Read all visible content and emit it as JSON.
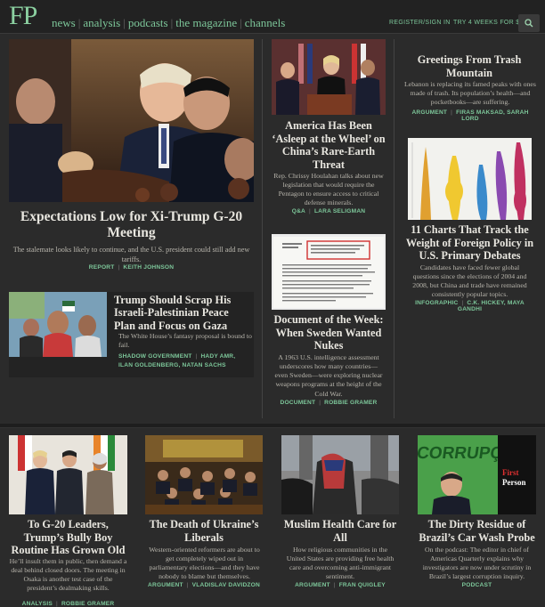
{
  "nav": {
    "logo": "FP",
    "links": [
      "news",
      "analysis",
      "podcasts",
      "the magazine",
      "channels"
    ],
    "register": "REGISTER/SIGN IN",
    "trial": "TRY 4 WEEKS FOR $1"
  },
  "main": {
    "title": "Expectations Low for Xi-Trump G-20 Meeting",
    "dek": "The stalemate looks likely to continue, and the U.S. president could still add new tariffs.",
    "type": "REPORT",
    "author": "KEITH JOHNSON"
  },
  "gaza": {
    "title": "Trump Should Scrap His Israeli-Palestinian Peace Plan and Focus on Gaza",
    "dek": "The White House’s fantasy proposal is bound to fail.",
    "type": "SHADOW GOVERNMENT",
    "author": "HADY AMR, ILAN GOLDENBERG, NATAN SACHS"
  },
  "rare": {
    "title": "America Has Been ‘Asleep at the Wheel’ on China’s Rare-Earth Threat",
    "dek": "Rep. Chrissy Houlahan talks about new legislation that would require the Pentagon to ensure access to critical defense minerals.",
    "type": "Q&A",
    "author": "LARA SELIGMAN"
  },
  "sweden": {
    "title": "Document of the Week: When Sweden Wanted Nukes",
    "dek": "A 1963 U.S. intelligence assessment underscores how many countries—even Sweden—were exploring nuclear weapons programs at the height of the Cold War.",
    "type": "DOCUMENT",
    "author": "ROBBIE GRAMER"
  },
  "trash": {
    "title": "Greetings From Trash Mountain",
    "dek": "Lebanon is replacing its famed peaks with ones made of trash. Its population’s health—and pocketbooks—are suffering.",
    "type": "ARGUMENT",
    "author": "FIRAS MAKSAD, SARAH LORD"
  },
  "charts": {
    "title": "11 Charts That Track the Weight of Foreign Policy in U.S. Primary Debates",
    "dek": "Candidates have faced fewer global questions since the elections of 2004 and 2008, but China and trade have remained consistently popular topics.",
    "type": "INFOGRAPHIC",
    "author": "C.K. HICKEY, MAYA GANDHI"
  },
  "bottom": [
    {
      "title": "To G-20 Leaders, Trump’s Bully Boy Routine Has Grown Old",
      "dek": "He’ll insult them in public, then demand a deal behind closed doors. The meeting in Osaka is another test case of the president’s dealmaking skills.",
      "type": "ANALYSIS",
      "author": "ROBBIE GRAMER"
    },
    {
      "title": "The Death of Ukraine’s Liberals",
      "dek": "Western-oriented reformers are about to get completely wiped out in parliamentary elections—and they have nobody to blame but themselves.",
      "type": "ARGUMENT",
      "author": "VLADISLAV DAVIDZON"
    },
    {
      "title": "Muslim Health Care for All",
      "dek": "How religious communities in the United States are providing free health care and overcoming anti-immigrant sentiment.",
      "type": "ARGUMENT",
      "author": "FRAN QUIGLEY"
    },
    {
      "title": "The Dirty Residue of Brazil’s Car Wash Probe",
      "dek": "On the podcast: The editor in chief of Americas Quarterly explains why investigators are now under scrutiny in Brazil’s largest corruption inquiry.",
      "type": "PODCAST",
      "author": ""
    }
  ],
  "image_text": {
    "corruption": "CORRUPÇ",
    "first_person_1": "First",
    "first_person_2": "Person"
  }
}
